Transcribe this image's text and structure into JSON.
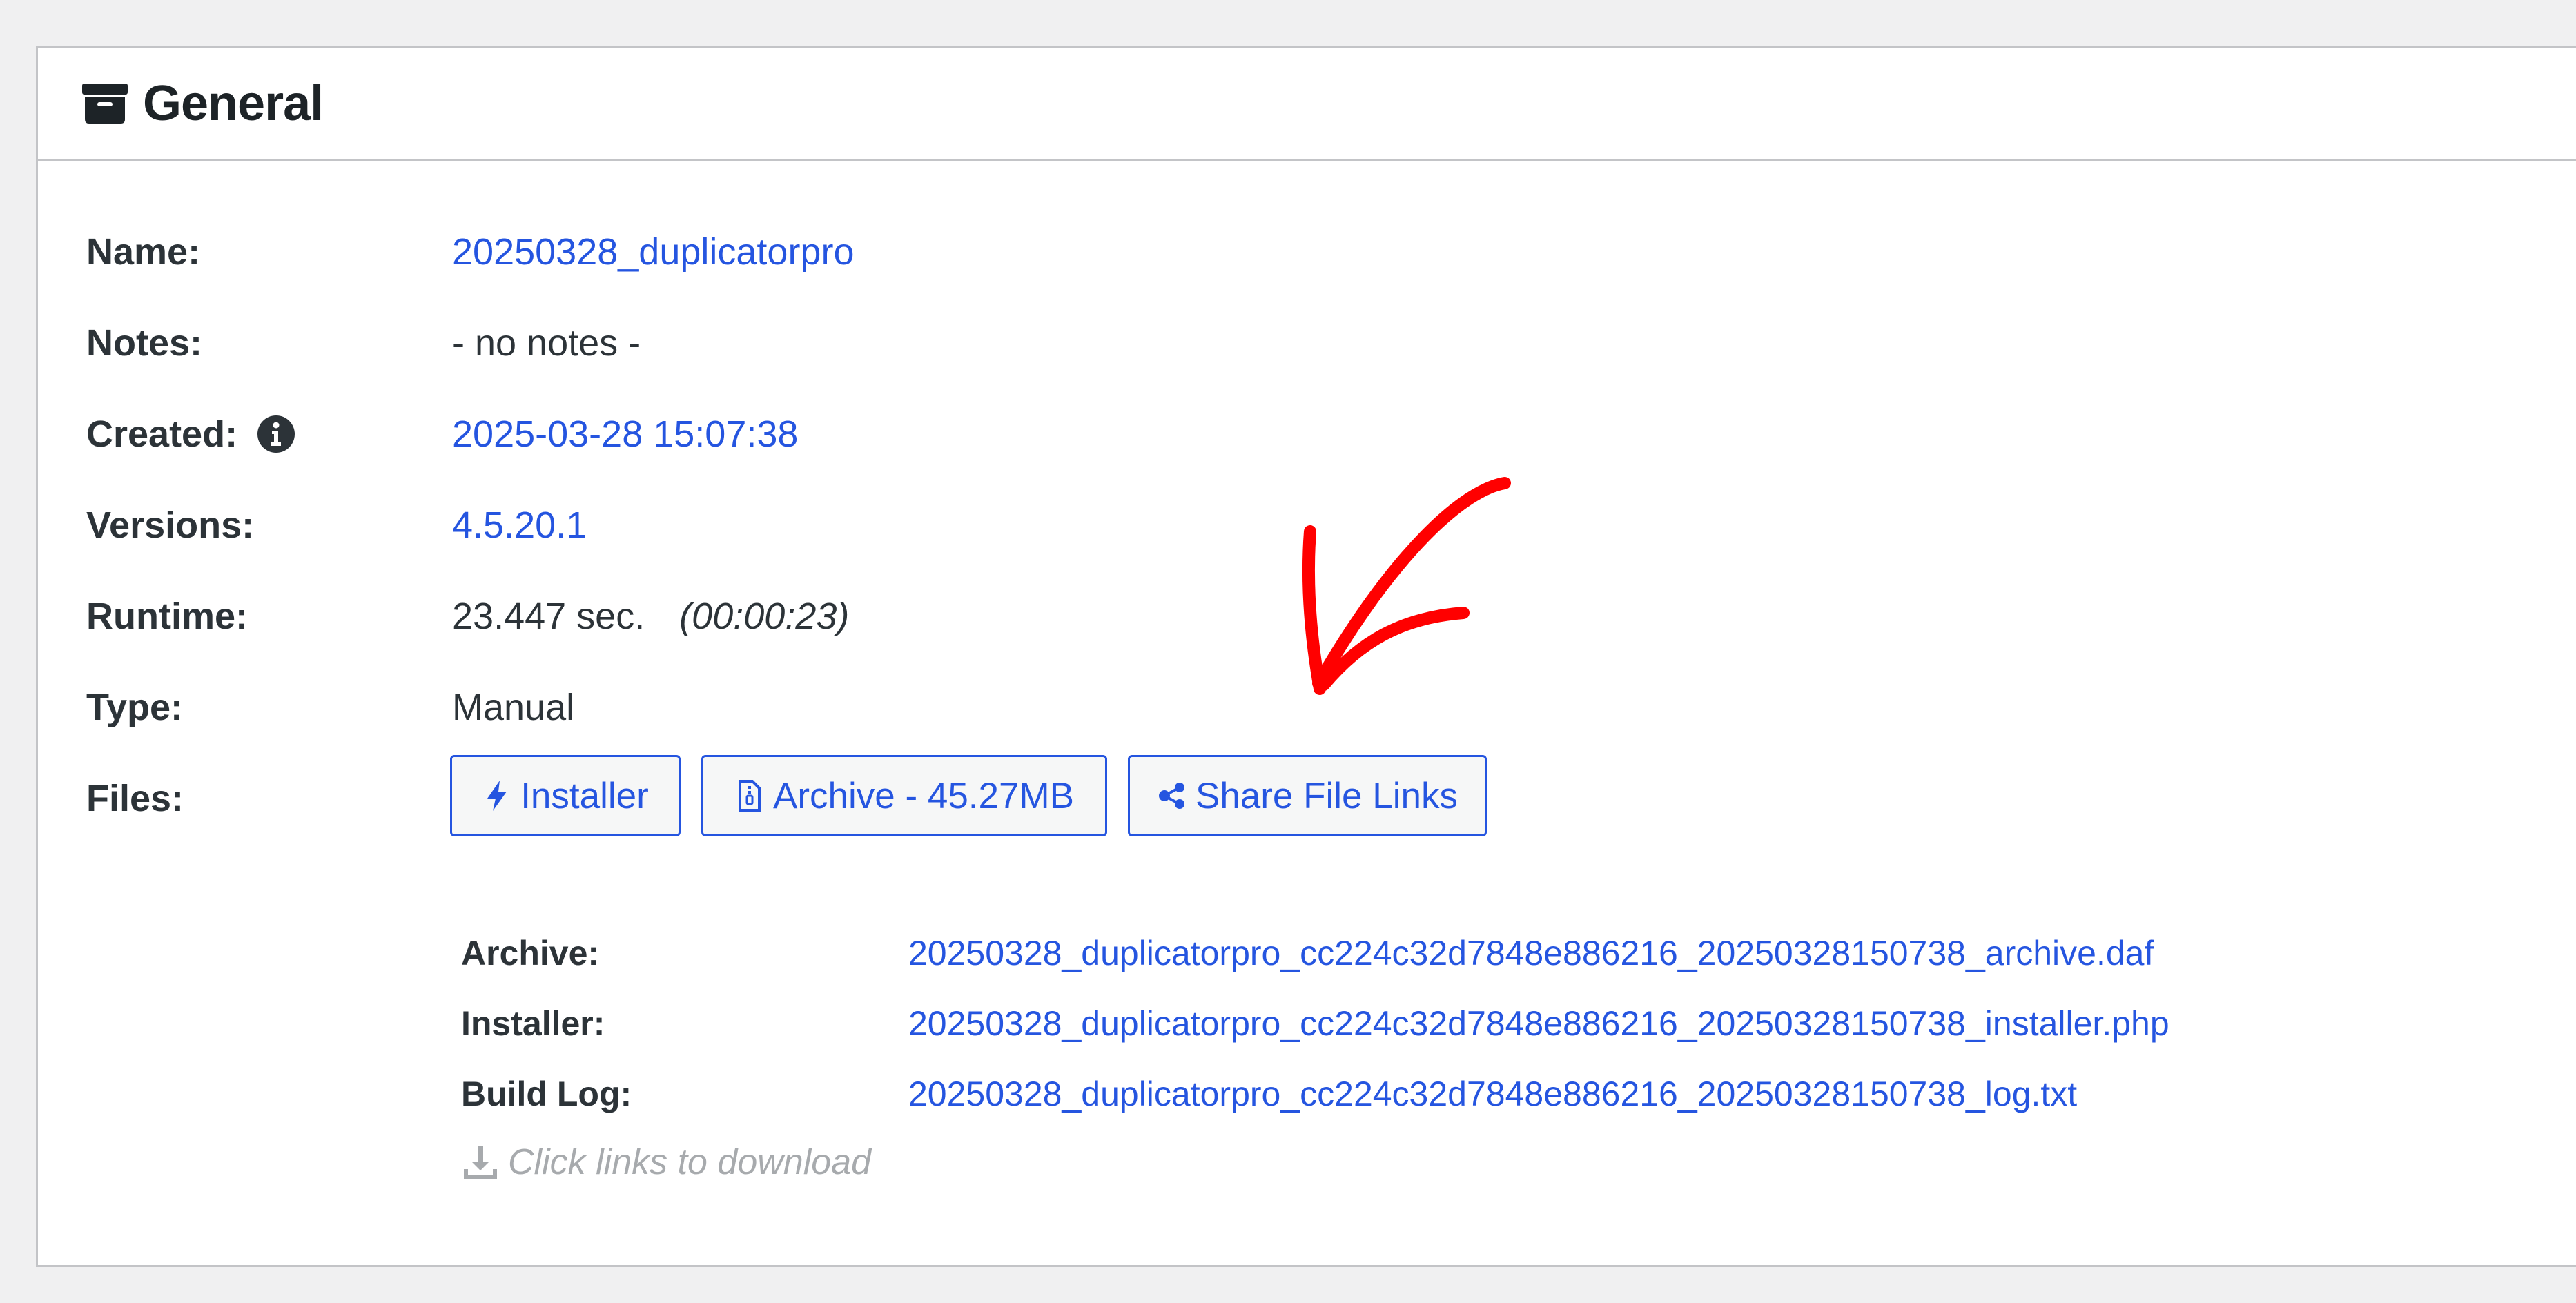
{
  "panel": {
    "title": "General",
    "title_icon": "archive-box-icon"
  },
  "details": {
    "name": {
      "label": "Name:",
      "value": "20250328_duplicatorpro"
    },
    "notes": {
      "label": "Notes:",
      "value": "- no notes -"
    },
    "created": {
      "label": "Created:",
      "value": "2025-03-28 15:07:38",
      "icon": "info-icon"
    },
    "versions": {
      "label": "Versions:",
      "value": "4.5.20.1"
    },
    "runtime": {
      "label": "Runtime:",
      "value": "23.447 sec.",
      "paren": "(00:00:23)"
    },
    "type": {
      "label": "Type:",
      "value": "Manual"
    },
    "files": {
      "label": "Files:"
    }
  },
  "buttons": {
    "installer": {
      "label": "Installer",
      "icon": "bolt-icon"
    },
    "archive": {
      "label": "Archive - 45.27MB",
      "icon": "file-zip-icon"
    },
    "share": {
      "label": "Share File Links",
      "icon": "share-icon"
    }
  },
  "file_links": [
    {
      "label": "Archive:",
      "value": "20250328_duplicatorpro_cc224c32d7848e886216_20250328150738_archive.daf"
    },
    {
      "label": "Installer:",
      "value": "20250328_duplicatorpro_cc224c32d7848e886216_20250328150738_installer.php"
    },
    {
      "label": "Build Log:",
      "value": "20250328_duplicatorpro_cc224c32d7848e886216_20250328150738_log.txt"
    }
  ],
  "hint": {
    "text": "Click links to download",
    "icon": "download-icon"
  },
  "colors": {
    "link": "#2555e0",
    "annotation_arrow": "#ff0000",
    "background": "#f0f0f1",
    "panel": "#ffffff"
  }
}
